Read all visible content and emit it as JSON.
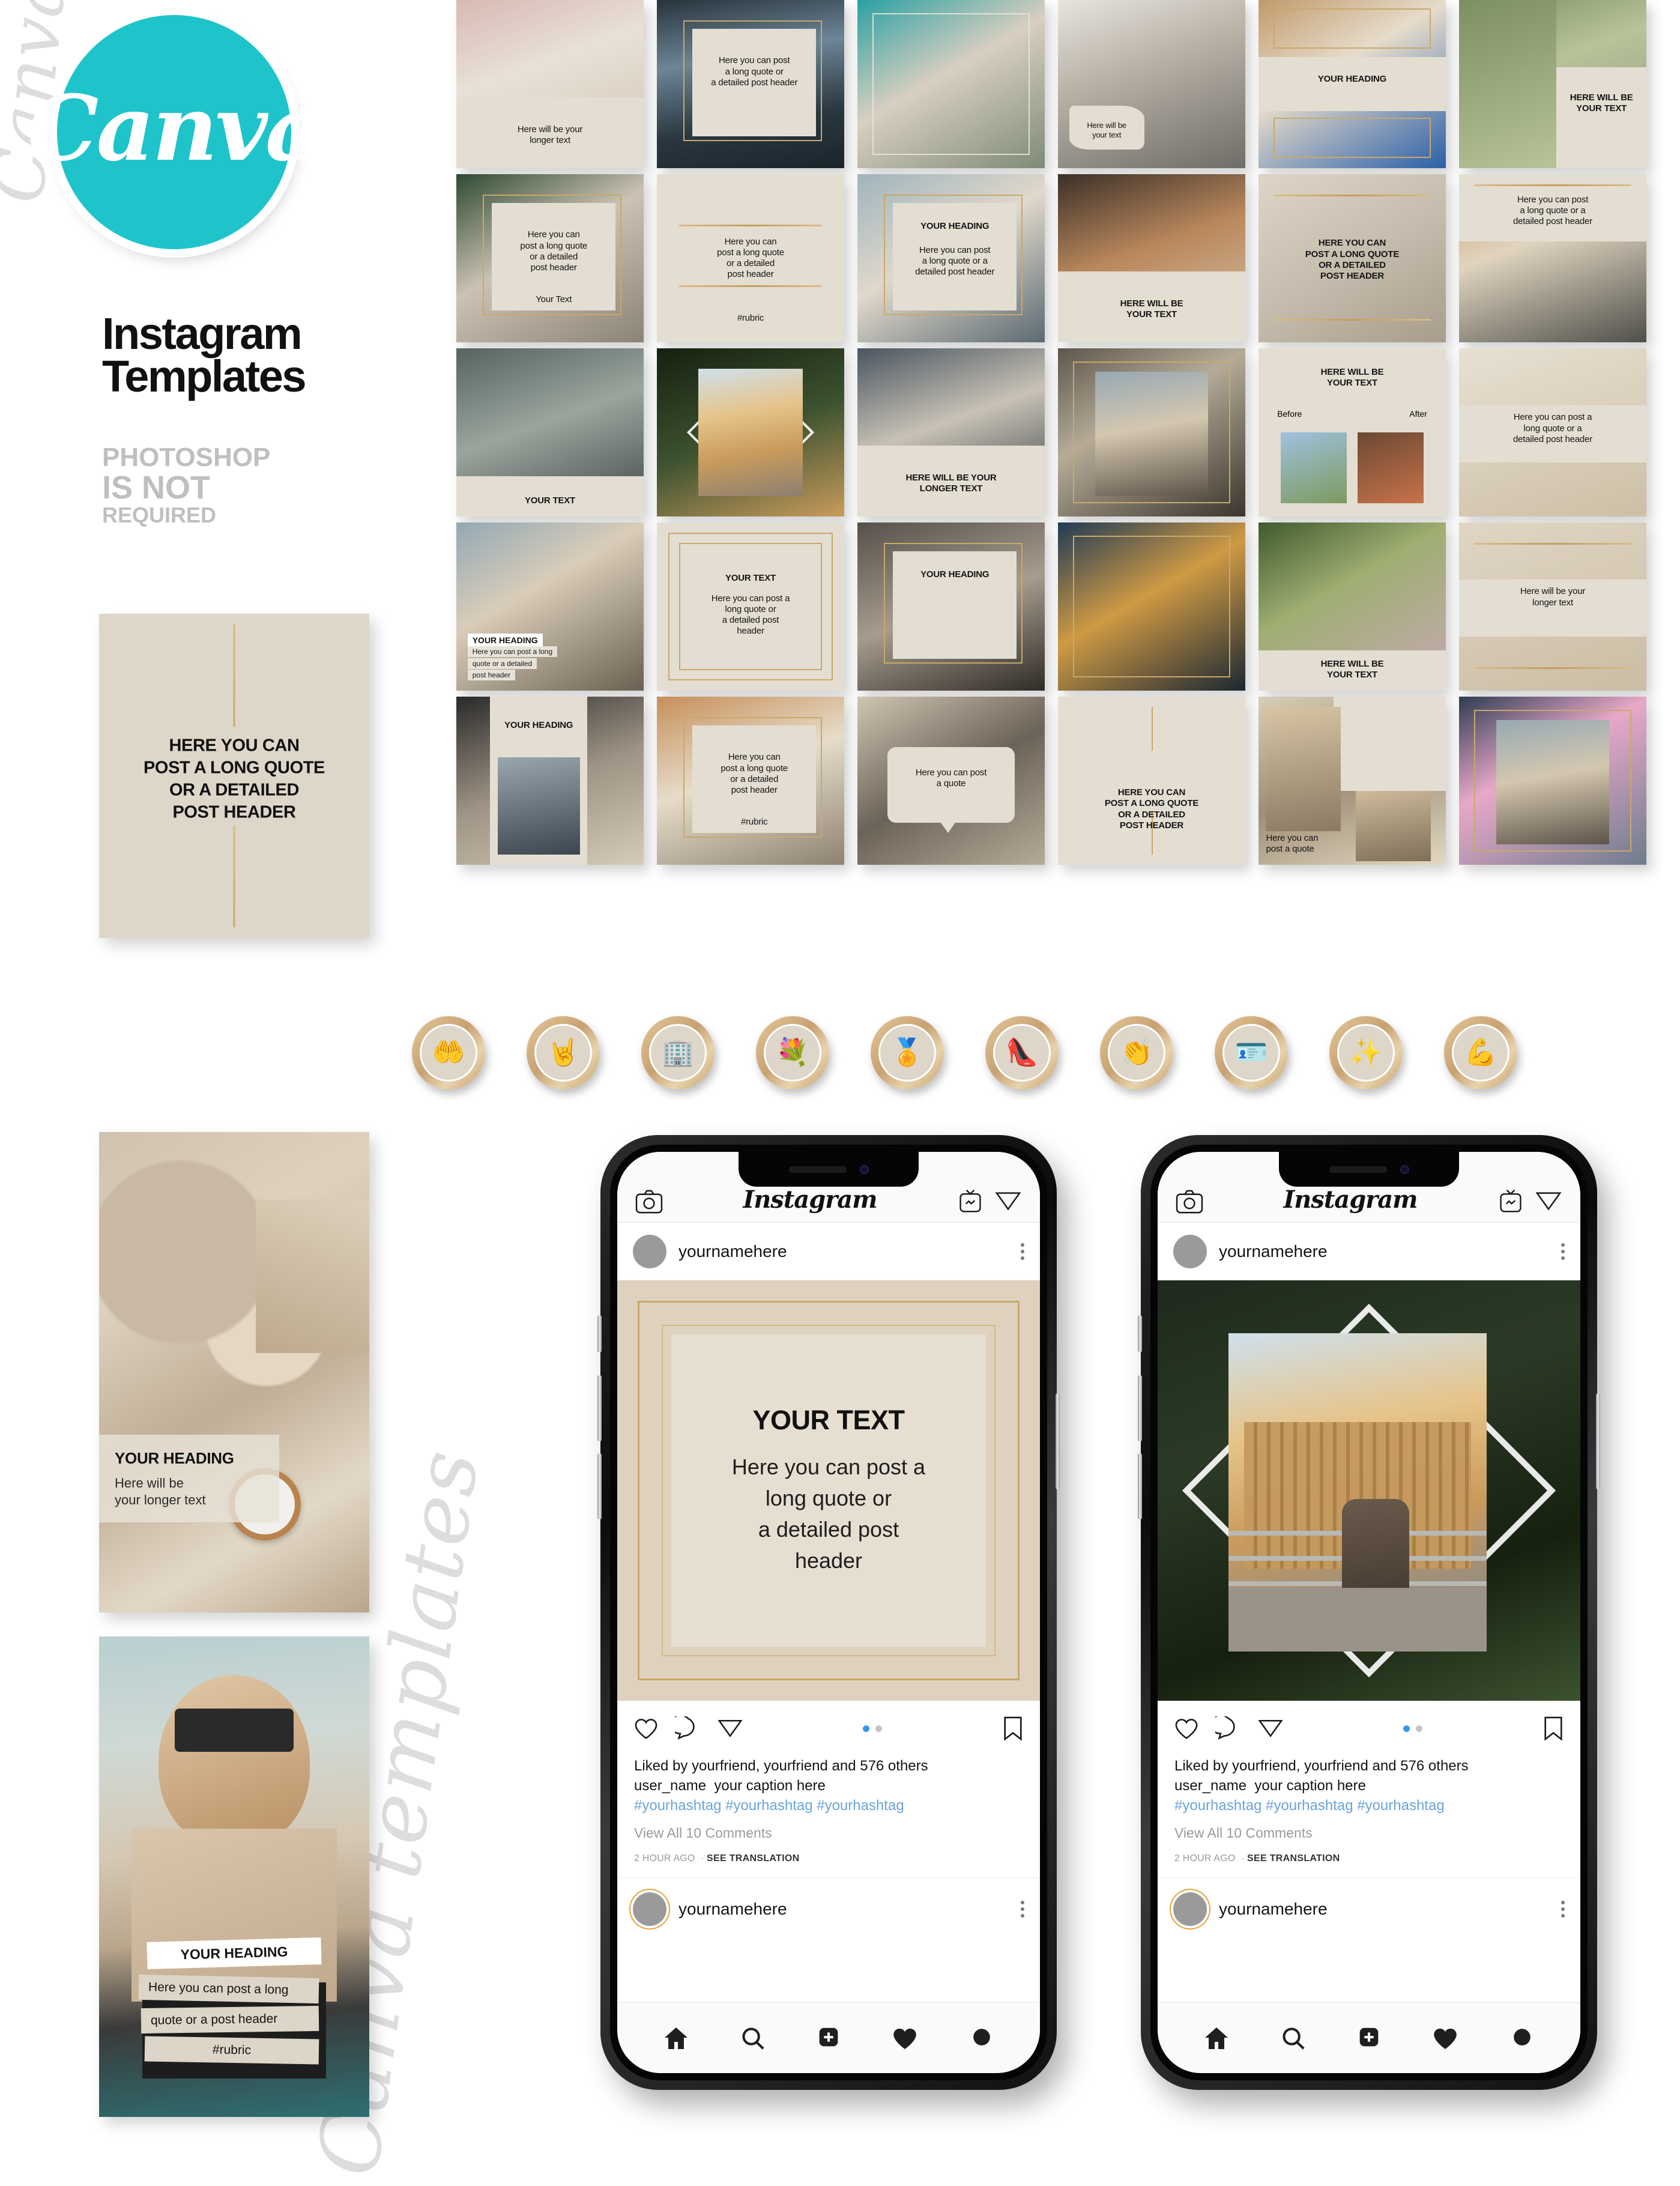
{
  "brand": {
    "logo_text": "Canva",
    "title_line1": "Instagram",
    "title_line2": "Templates",
    "sub_line1": "PHOTOSHOP",
    "sub_line2": "IS NOT",
    "sub_line3": "REQUIRED",
    "watermark": "Canva templates",
    "accent_color": "#1FC4CB",
    "beige_color": "#E4DED2",
    "gold_color": "#C9A86B"
  },
  "left_panel": {
    "quote_card": "HERE YOU CAN\nPOST A LONG QUOTE\nOR A DETAILED\nPOST HEADER",
    "quote_card_lines": [
      "HERE YOU CAN",
      "POST A LONG QUOTE",
      "OR A DETAILED",
      "POST HEADER"
    ],
    "story_watch": {
      "heading": "YOUR HEADING",
      "body_line1": "Here will be",
      "body_line2": "your longer text"
    },
    "story_sunglasses": {
      "heading": "YOUR HEADING",
      "body_line1": "Here you can post a long",
      "body_line2": "quote or a post header",
      "rubric": "#rubric"
    }
  },
  "grid": {
    "columns": 6,
    "rows": 5,
    "items": [
      {
        "id": "r1c1",
        "layout": "photo-top-text-bottom",
        "text": [
          "Here will be your",
          "longer text"
        ],
        "style": "regular"
      },
      {
        "id": "r1c2",
        "layout": "framed-card-on-photo",
        "text": [
          "Here you can post",
          "a long quote or",
          "a detailed post header"
        ],
        "style": "regular"
      },
      {
        "id": "r1c3",
        "layout": "photo-with-gold-frame",
        "text": [],
        "style": "none"
      },
      {
        "id": "r1c4",
        "layout": "photo-with-torn-label",
        "text": [
          "Here will be",
          "your text"
        ],
        "style": "small"
      },
      {
        "id": "r1c5",
        "layout": "photo-band-heading-photo",
        "text": [
          "YOUR HEADING"
        ],
        "style": "bold"
      },
      {
        "id": "r1c6",
        "layout": "dual-photo-text-right",
        "text": [
          "HERE WILL BE",
          "YOUR TEXT"
        ],
        "style": "bold"
      },
      {
        "id": "r2c1",
        "layout": "card-on-photo-gold-frame",
        "text": [
          "Here you can",
          "post a long quote",
          "or a detailed",
          "post header"
        ],
        "footer": "Your Text",
        "style": "regular"
      },
      {
        "id": "r2c2",
        "layout": "beige-with-gold-rules",
        "text": [
          "Here you can",
          "post a long quote",
          "or a detailed",
          "post header"
        ],
        "footer": "#rubric",
        "style": "regular"
      },
      {
        "id": "r2c3",
        "layout": "card-on-photo-heading",
        "heading": "YOUR HEADING",
        "text": [
          "Here you can post",
          "a long quote or a",
          "detailed post header"
        ],
        "style": "regular"
      },
      {
        "id": "r2c4",
        "layout": "photo-top-text-bottom",
        "text": [
          "HERE WILL BE",
          "YOUR TEXT"
        ],
        "style": "bold"
      },
      {
        "id": "r2c5",
        "layout": "text-over-texture",
        "text": [
          "HERE YOU CAN",
          "POST A LONG QUOTE",
          "OR A DETAILED",
          "POST HEADER"
        ],
        "style": "bold"
      },
      {
        "id": "r2c6",
        "layout": "text-top-photo-bottom",
        "text": [
          "Here you can post",
          "a long quote or a",
          "detailed post header"
        ],
        "style": "regular"
      },
      {
        "id": "r3c1",
        "layout": "photo-text-band-bottom",
        "text": [
          "YOUR TEXT"
        ],
        "style": "bold"
      },
      {
        "id": "r3c2",
        "layout": "photo-diamond-frame",
        "text": [],
        "style": "none"
      },
      {
        "id": "r3c3",
        "layout": "photo-top-text-bottom",
        "text": [
          "HERE WILL BE YOUR",
          "LONGER TEXT"
        ],
        "style": "bold"
      },
      {
        "id": "r3c4",
        "layout": "photo-inset-frame",
        "text": [],
        "style": "none"
      },
      {
        "id": "r3c5",
        "layout": "before-after",
        "heading": [
          "HERE WILL BE",
          "YOUR TEXT"
        ],
        "labels": [
          "Before",
          "After"
        ],
        "style": "bold"
      },
      {
        "id": "r3c6",
        "layout": "text-band-middle",
        "text": [
          "Here you can post a",
          "long quote or a",
          "detailed post header"
        ],
        "style": "regular"
      },
      {
        "id": "r4c1",
        "layout": "photo-with-tapes",
        "heading": "YOUR HEADING",
        "text": [
          "Here you can post a long",
          "quote or a detailed",
          "post header"
        ],
        "style": "bold"
      },
      {
        "id": "r4c2",
        "layout": "double-gold-frame",
        "heading": "YOUR TEXT",
        "text": [
          "Here you can post a",
          "long quote or",
          "a detailed post",
          "header"
        ],
        "style": "regular"
      },
      {
        "id": "r4c3",
        "layout": "card-on-photo-heading-only",
        "heading": "YOUR HEADING",
        "text": [],
        "style": "bold"
      },
      {
        "id": "r4c4",
        "layout": "photo-inset-gold",
        "text": [],
        "style": "none"
      },
      {
        "id": "r4c5",
        "layout": "photo-text-band-bottom",
        "text": [
          "HERE WILL BE",
          "YOUR TEXT"
        ],
        "style": "bold"
      },
      {
        "id": "r4c6",
        "layout": "text-over-photo-gold-rules",
        "text": [
          "Here will be your",
          "longer text"
        ],
        "style": "regular"
      },
      {
        "id": "r5c1",
        "layout": "heading-photo-collage",
        "heading": "YOUR HEADING",
        "text": [],
        "style": "bold"
      },
      {
        "id": "r5c2",
        "layout": "card-on-photo-gold-frame",
        "text": [
          "Here you can",
          "post a long quote",
          "or a detailed",
          "post header"
        ],
        "footer": "#rubric",
        "style": "regular"
      },
      {
        "id": "r5c3",
        "layout": "speech-bubble",
        "text": [
          "Here you can post",
          "a quote"
        ],
        "style": "regular"
      },
      {
        "id": "r5c4",
        "layout": "beige-centered-text",
        "text": [
          "HERE YOU CAN",
          "POST A LONG QUOTE",
          "OR A DETAILED",
          "POST HEADER"
        ],
        "style": "bold"
      },
      {
        "id": "r5c5",
        "layout": "dual-photo-quote",
        "text": [
          "Here you can",
          "post a quote"
        ],
        "style": "regular"
      },
      {
        "id": "r5c6",
        "layout": "photo-gold-double-frame",
        "text": [],
        "style": "none"
      }
    ]
  },
  "highlights": {
    "count": 10,
    "icons": [
      "praying-hands-icon",
      "rock-hand-icon",
      "buildings-icon",
      "flower-bouquet-icon",
      "star-badge-icon",
      "high-heel-shoe-icon",
      "clapping-hands-icon",
      "id-card-icon",
      "stars-hand-icon",
      "flexed-arm-icon"
    ]
  },
  "phones": [
    {
      "id": "phone-left",
      "header": {
        "camera_icon": "camera-icon",
        "logo": "Instagram",
        "igtv_icon": "igtv-icon",
        "send_icon": "send-icon"
      },
      "post_user": "yournamehere",
      "media": {
        "type": "beige-gold-frame-quote",
        "heading": "YOUR TEXT",
        "body_lines": [
          "Here you can post a",
          "long quote or",
          "a detailed post",
          "header"
        ]
      },
      "actions": {
        "like_icon": "heart-outline-icon",
        "comment_icon": "comment-icon",
        "share_icon": "send-icon",
        "save_icon": "bookmark-icon",
        "pager_count": 2,
        "pager_active": 0
      },
      "caption": {
        "likes": "Liked by yourfriend, yourfriend and 576 others",
        "username": "user_name",
        "caption_text": "your caption here",
        "hashtags": "#yourhashtag #yourhashtag #yourhashtag",
        "comments_link": "View All 10 Comments",
        "timestamp": "2 HOUR AGO",
        "translate": "SEE TRANSLATION"
      },
      "footer_user": "yournamehere",
      "tabbar": [
        "home-icon",
        "search-icon",
        "add-post-icon",
        "heart-filled-icon",
        "profile-icon"
      ]
    },
    {
      "id": "phone-right",
      "header": {
        "camera_icon": "camera-icon",
        "logo": "Instagram",
        "igtv_icon": "igtv-icon",
        "send_icon": "send-icon"
      },
      "post_user": "yournamehere",
      "media": {
        "type": "photo-diamond-frame",
        "heading": "",
        "body_lines": []
      },
      "actions": {
        "like_icon": "heart-outline-icon",
        "comment_icon": "comment-icon",
        "share_icon": "send-icon",
        "save_icon": "bookmark-icon",
        "pager_count": 2,
        "pager_active": 0
      },
      "caption": {
        "likes": "Liked by yourfriend, yourfriend and 576 others",
        "username": "user_name",
        "caption_text": "your caption here",
        "hashtags": "#yourhashtag #yourhashtag #yourhashtag",
        "comments_link": "View All 10 Comments",
        "timestamp": "2 HOUR AGO",
        "translate": "SEE TRANSLATION"
      },
      "footer_user": "yournamehere",
      "tabbar": [
        "home-icon",
        "search-icon",
        "add-post-icon",
        "heart-filled-icon",
        "profile-icon"
      ]
    }
  ]
}
